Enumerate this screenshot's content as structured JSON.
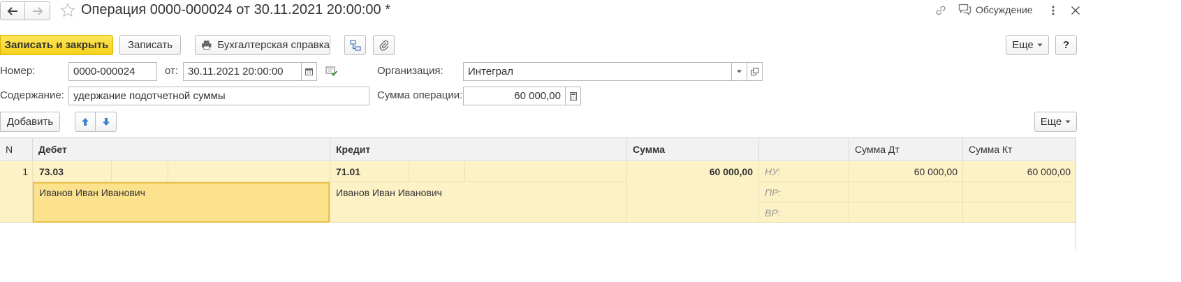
{
  "header": {
    "title": "Операция 0000-000024 от 30.11.2021 20:00:00 *",
    "discussion": "Обсуждение"
  },
  "toolbar": {
    "save_close": "Записать и закрыть",
    "save": "Записать",
    "report": "Бухгалтерская справка",
    "more": "Еще",
    "help": "?"
  },
  "form": {
    "number_label": "Номер:",
    "number_value": "0000-000024",
    "date_label": "от:",
    "date_value": "30.11.2021 20:00:00",
    "org_label": "Организация:",
    "org_value": "Интеграл",
    "content_label": "Содержание:",
    "content_value": "удержание подотчетной суммы",
    "sum_label": "Сумма операции:",
    "sum_value": "60 000,00"
  },
  "table_toolbar": {
    "add": "Добавить",
    "more": "Еще"
  },
  "table": {
    "columns": {
      "n": "N",
      "debit": "Дебет",
      "credit": "Кредит",
      "sum": "Сумма",
      "sum_dt": "Сумма Дт",
      "sum_kt": "Сумма Кт"
    },
    "rows": [
      {
        "n": "1",
        "debit_account": "73.03",
        "debit_subconto": "Иванов Иван Иванович",
        "credit_account": "71.01",
        "credit_subconto": "Иванов Иван Иванович",
        "sum": "60 000,00",
        "tax": [
          {
            "label": "НУ:",
            "dt": "60 000,00",
            "kt": "60 000,00"
          },
          {
            "label": "ПР:",
            "dt": "",
            "kt": ""
          },
          {
            "label": "ВР:",
            "dt": "",
            "kt": ""
          }
        ]
      }
    ]
  }
}
